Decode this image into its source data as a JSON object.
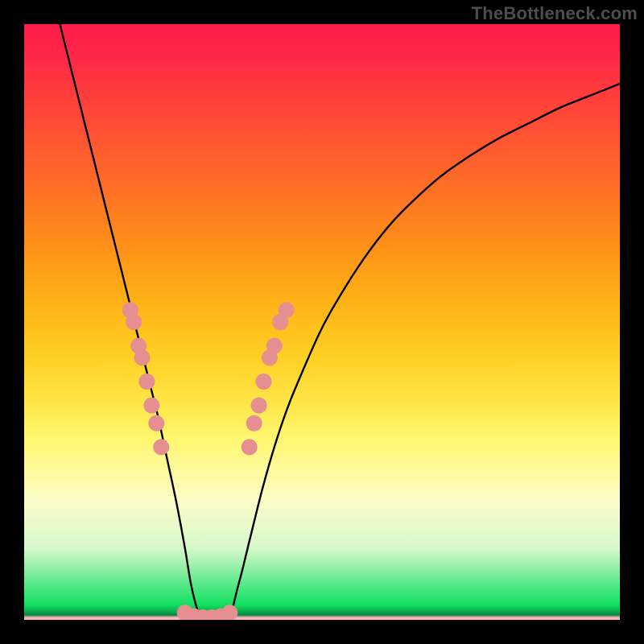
{
  "watermark": "TheBottleneck.com",
  "chart_data": {
    "type": "line",
    "title": "",
    "xlabel": "",
    "ylabel": "",
    "xlim": [
      0,
      100
    ],
    "ylim": [
      0,
      100
    ],
    "grid": false,
    "legend": false,
    "series": [
      {
        "name": "curve",
        "color": "#000000",
        "x": [
          6,
          8,
          10,
          12,
          14,
          16,
          18,
          19.5,
          21,
          22.5,
          24,
          25.5,
          27,
          28,
          29,
          30,
          34,
          36,
          38,
          40,
          42,
          44,
          46,
          50,
          54,
          58,
          62,
          66,
          70,
          75,
          80,
          85,
          90,
          95,
          100
        ],
        "y": [
          100,
          92,
          84,
          76,
          68,
          60,
          52,
          46,
          40,
          34,
          27,
          20,
          12,
          6,
          2,
          0,
          0,
          6,
          14,
          22,
          29,
          35,
          40,
          49,
          56,
          62,
          67,
          71,
          74.5,
          78,
          81,
          83.5,
          86,
          88,
          90
        ]
      }
    ],
    "markers": {
      "name": "highlight-dots",
      "color": "#e58f91",
      "radius": 10,
      "points": [
        {
          "x": 17.8,
          "y": 52
        },
        {
          "x": 18.4,
          "y": 50
        },
        {
          "x": 19.2,
          "y": 46
        },
        {
          "x": 19.8,
          "y": 44
        },
        {
          "x": 20.6,
          "y": 40
        },
        {
          "x": 21.4,
          "y": 36
        },
        {
          "x": 22.2,
          "y": 33
        },
        {
          "x": 23.0,
          "y": 29
        },
        {
          "x": 27.0,
          "y": 1.2
        },
        {
          "x": 28.5,
          "y": 0.6
        },
        {
          "x": 30.0,
          "y": 0.4
        },
        {
          "x": 31.5,
          "y": 0.4
        },
        {
          "x": 33.0,
          "y": 0.6
        },
        {
          "x": 34.5,
          "y": 1.2
        },
        {
          "x": 37.8,
          "y": 29
        },
        {
          "x": 38.6,
          "y": 33
        },
        {
          "x": 39.4,
          "y": 36
        },
        {
          "x": 40.2,
          "y": 40
        },
        {
          "x": 41.2,
          "y": 44
        },
        {
          "x": 42.0,
          "y": 46
        },
        {
          "x": 43.0,
          "y": 50
        },
        {
          "x": 44.0,
          "y": 52
        }
      ]
    },
    "background_gradient": {
      "direction": "top-to-bottom",
      "stops": [
        {
          "pos": 0,
          "color": "#ff1a4a"
        },
        {
          "pos": 50,
          "color": "#ffd024"
        },
        {
          "pos": 80,
          "color": "#fcfcc8"
        },
        {
          "pos": 97,
          "color": "#10e060"
        },
        {
          "pos": 100,
          "color": "#f8b5c0"
        }
      ]
    }
  }
}
